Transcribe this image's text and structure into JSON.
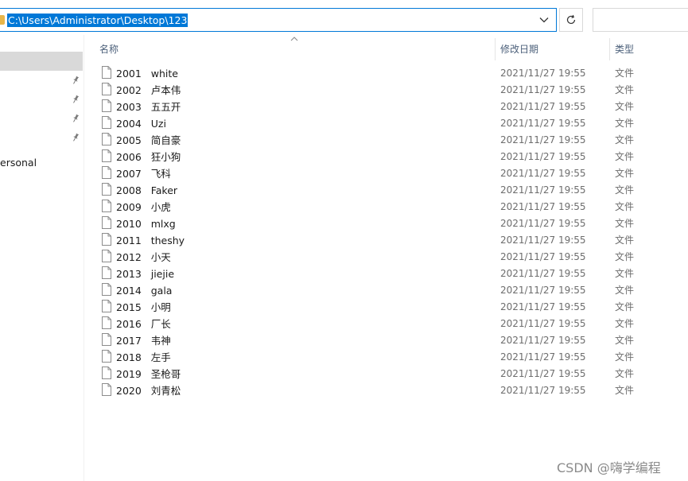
{
  "address_bar": {
    "path": "C:\\Users\\Administrator\\Desktop\\123"
  },
  "nav_pane": {
    "partial_item_label": "ersonal"
  },
  "columns": {
    "name": "名称",
    "date_modified": "修改日期",
    "type": "类型"
  },
  "files": [
    {
      "name": "2001   white",
      "date": "2021/11/27 19:55",
      "type": "文件"
    },
    {
      "name": "2002   卢本伟",
      "date": "2021/11/27 19:55",
      "type": "文件"
    },
    {
      "name": "2003   五五开",
      "date": "2021/11/27 19:55",
      "type": "文件"
    },
    {
      "name": "2004   Uzi",
      "date": "2021/11/27 19:55",
      "type": "文件"
    },
    {
      "name": "2005   简自豪",
      "date": "2021/11/27 19:55",
      "type": "文件"
    },
    {
      "name": "2006   狂小狗",
      "date": "2021/11/27 19:55",
      "type": "文件"
    },
    {
      "name": "2007   飞科",
      "date": "2021/11/27 19:55",
      "type": "文件"
    },
    {
      "name": "2008   Faker",
      "date": "2021/11/27 19:55",
      "type": "文件"
    },
    {
      "name": "2009   小虎",
      "date": "2021/11/27 19:55",
      "type": "文件"
    },
    {
      "name": "2010   mlxg",
      "date": "2021/11/27 19:55",
      "type": "文件"
    },
    {
      "name": "2011   theshy",
      "date": "2021/11/27 19:55",
      "type": "文件"
    },
    {
      "name": "2012   小天",
      "date": "2021/11/27 19:55",
      "type": "文件"
    },
    {
      "name": "2013   jiejie",
      "date": "2021/11/27 19:55",
      "type": "文件"
    },
    {
      "name": "2014   gala",
      "date": "2021/11/27 19:55",
      "type": "文件"
    },
    {
      "name": "2015   小明",
      "date": "2021/11/27 19:55",
      "type": "文件"
    },
    {
      "name": "2016   厂长",
      "date": "2021/11/27 19:55",
      "type": "文件"
    },
    {
      "name": "2017   韦神",
      "date": "2021/11/27 19:55",
      "type": "文件"
    },
    {
      "name": "2018   左手",
      "date": "2021/11/27 19:55",
      "type": "文件"
    },
    {
      "name": "2019   圣枪哥",
      "date": "2021/11/27 19:55",
      "type": "文件"
    },
    {
      "name": "2020   刘青松",
      "date": "2021/11/27 19:55",
      "type": "文件"
    }
  ],
  "watermark": "CSDN @嗨学编程",
  "colors": {
    "selection": "#0078d7",
    "nav_selected": "#d9d9d9",
    "header_text": "#4c607a",
    "secondary_text": "#6d6d6d"
  },
  "icons": {
    "folder": "folder-icon",
    "dropdown": "chevron-down-icon",
    "refresh": "refresh-icon",
    "pin": "pin-icon",
    "sort": "sort-up-icon",
    "file": "file-icon"
  }
}
